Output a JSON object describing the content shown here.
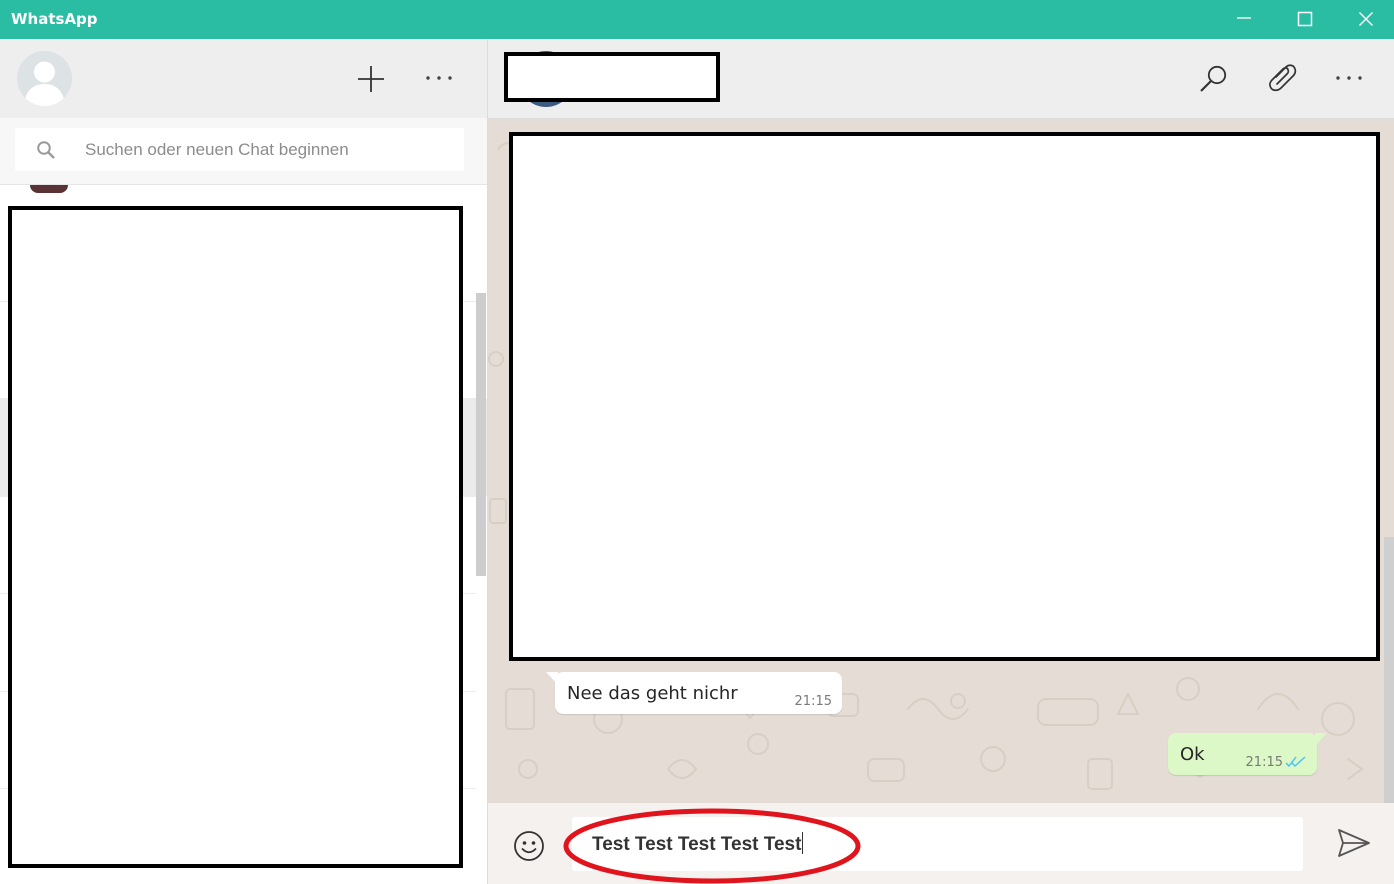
{
  "window": {
    "title": "WhatsApp",
    "controls": [
      "minimize",
      "maximize",
      "close"
    ],
    "titlebar_color": "#2bbca4"
  },
  "sidebar": {
    "header_icons": [
      "avatar-placeholder",
      "plus-icon",
      "more-icon"
    ],
    "search": {
      "placeholder": "Suchen oder neuen Chat beginnen",
      "icon": "search-icon"
    },
    "chat_list_redacted": true
  },
  "chat": {
    "header_icons": [
      "search-icon",
      "paperclip-icon",
      "more-icon"
    ],
    "contact_name_redacted": true,
    "messages": [
      {
        "direction": "incoming",
        "text": "Nee das geht nichr",
        "time": "21:15"
      },
      {
        "direction": "outgoing",
        "text": "Ok",
        "time": "21:15",
        "status": "read"
      }
    ],
    "compose": {
      "value": "Test Test Test Test Test",
      "icons": [
        "smiley-icon",
        "send-icon"
      ]
    },
    "colors": {
      "wallpaper": "#e5ddd5",
      "incoming_bubble": "#ffffff",
      "outgoing_bubble": "#dcf8c6",
      "read_ticks": "#4fc3f7",
      "annotation": "#e0141c"
    }
  }
}
